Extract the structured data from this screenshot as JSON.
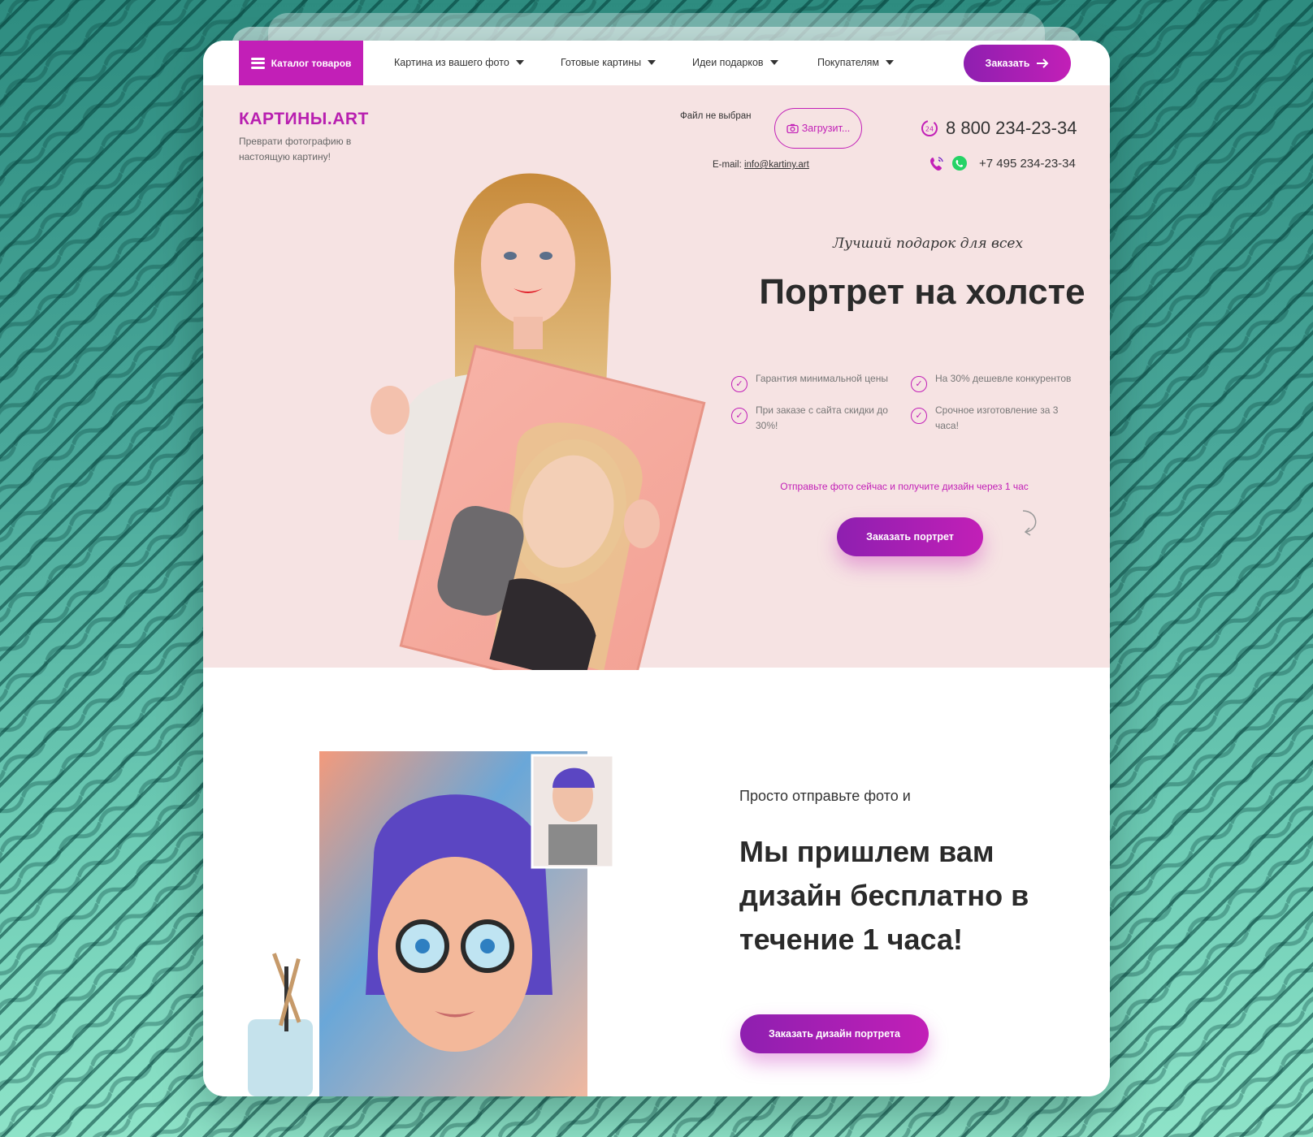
{
  "nav": {
    "catalog_label": "Каталог товаров",
    "items": [
      {
        "label": "Картина из вашего фото"
      },
      {
        "label": "Готовые картины"
      },
      {
        "label": "Идеи подарков"
      },
      {
        "label": "Покупателям"
      }
    ],
    "order_label": "Заказать"
  },
  "header": {
    "logo": "КАРТИНЫ.ART",
    "tagline": "Преврати фотографию в настоящую картину!",
    "file_status": "Файл не выбран",
    "upload_label": "Загрузит...",
    "email_label": "E-mail:",
    "email": "info@kartiny.art",
    "phone_main": "8 800 234-23-34",
    "phone_secondary": "+7 495 234-23-34"
  },
  "hero": {
    "subtitle": "Лучший подарок для всех",
    "title": "Портрет на холсте",
    "features": [
      "Гарантия минимальной цены",
      "На 30% дешевле конкурентов",
      "При заказе с сайта скидки до 30%!",
      "Срочное изготовление за 3 часа!"
    ],
    "promo": "Отправьте фото сейчас и получите дизайн через 1 час",
    "cta_label": "Заказать портрет"
  },
  "design_section": {
    "lead": "Просто отправьте фото и",
    "title": "Мы пришлем вам дизайн бесплатно в течение 1 часа!",
    "cta_label": "Заказать дизайн портрета"
  },
  "colors": {
    "accent": "#c21fb7",
    "accent_dark": "#8e1fb0",
    "hero_bg": "#f6e3e3",
    "whatsapp": "#25d366"
  },
  "icons": [
    "menu-icon",
    "chevron-down-icon",
    "arrow-right-icon",
    "camera-icon",
    "phone-24-icon",
    "phone-icon",
    "whatsapp-icon",
    "check-circle-icon",
    "curved-arrow-icon"
  ]
}
